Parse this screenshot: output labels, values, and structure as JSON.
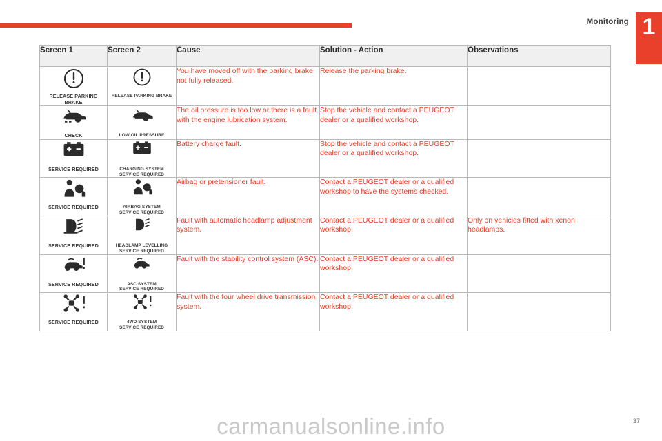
{
  "header": {
    "chapter_title": "Monitoring",
    "chapter_number": "1",
    "accent_color": "#e8402a"
  },
  "footer": {
    "page_number": "37",
    "watermark": "carmanualsonline.info"
  },
  "table": {
    "columns": [
      "Screen 1",
      "Screen 2",
      "Cause",
      "Solution - Action",
      "Observations"
    ],
    "rows": [
      {
        "screen1_icon": "parking-brake-warning-icon",
        "screen1_label": "RELEASE PARKING\nBRAKE",
        "screen2_icon": "parking-brake-warning-icon",
        "screen2_label": "RELEASE PARKING BRAKE",
        "cause": "You have moved off with the parking brake not fully released.",
        "solution": "Release the parking brake.",
        "observations": ""
      },
      {
        "screen1_icon": "oil-pressure-icon",
        "screen1_label": "CHECK",
        "screen2_icon": "oil-pressure-icon",
        "screen2_label": "LOW OIL PRESSURE",
        "cause": "The oil pressure is too low or there is a fault with the engine lubrication system.",
        "solution": "Stop the vehicle and contact a PEUGEOT dealer or a qualified workshop.",
        "observations": ""
      },
      {
        "screen1_icon": "battery-charge-icon",
        "screen1_label": "SERVICE REQUIRED",
        "screen2_icon": "battery-charge-icon",
        "screen2_label": "CHARGING SYSTEM\nSERVICE REQUIRED",
        "cause": "Battery charge fault.",
        "solution": "Stop the vehicle and contact a PEUGEOT dealer or a qualified workshop.",
        "observations": ""
      },
      {
        "screen1_icon": "airbag-icon",
        "screen1_label": "SERVICE REQUIRED",
        "screen2_icon": "airbag-icon",
        "screen2_label": "AIRBAG SYSTEM\nSERVICE REQUIRED",
        "cause": "Airbag or pretensioner fault.",
        "solution": "Contact a PEUGEOT dealer or a qualified workshop to have the systems checked.",
        "observations": ""
      },
      {
        "screen1_icon": "headlamp-levelling-icon",
        "screen1_label": "SERVICE REQUIRED",
        "screen2_icon": "headlamp-levelling-icon",
        "screen2_label": "HEADLAMP LEVELLING\nSERVICE REQUIRED",
        "cause": "Fault with automatic headlamp adjustment system.",
        "solution": "Contact a PEUGEOT dealer or a qualified workshop.",
        "observations": "Only on vehicles fitted with xenon headlamps."
      },
      {
        "screen1_icon": "stability-control-icon",
        "screen1_label": "SERVICE REQUIRED",
        "screen2_icon": "stability-control-icon",
        "screen2_label": "ASC SYSTEM\nSERVICE REQUIRED",
        "cause": "Fault with the stability control system (ASC).",
        "solution": "Contact a PEUGEOT dealer or a qualified workshop.",
        "observations": ""
      },
      {
        "screen1_icon": "four-wheel-drive-icon",
        "screen1_label": "SERVICE REQUIRED",
        "screen2_icon": "four-wheel-drive-icon",
        "screen2_label": "4WD SYSTEM\nSERVICE REQUIRED",
        "cause": "Fault with the four wheel drive transmission system.",
        "solution": "Contact a PEUGEOT dealer or a qualified workshop.",
        "observations": ""
      }
    ]
  }
}
